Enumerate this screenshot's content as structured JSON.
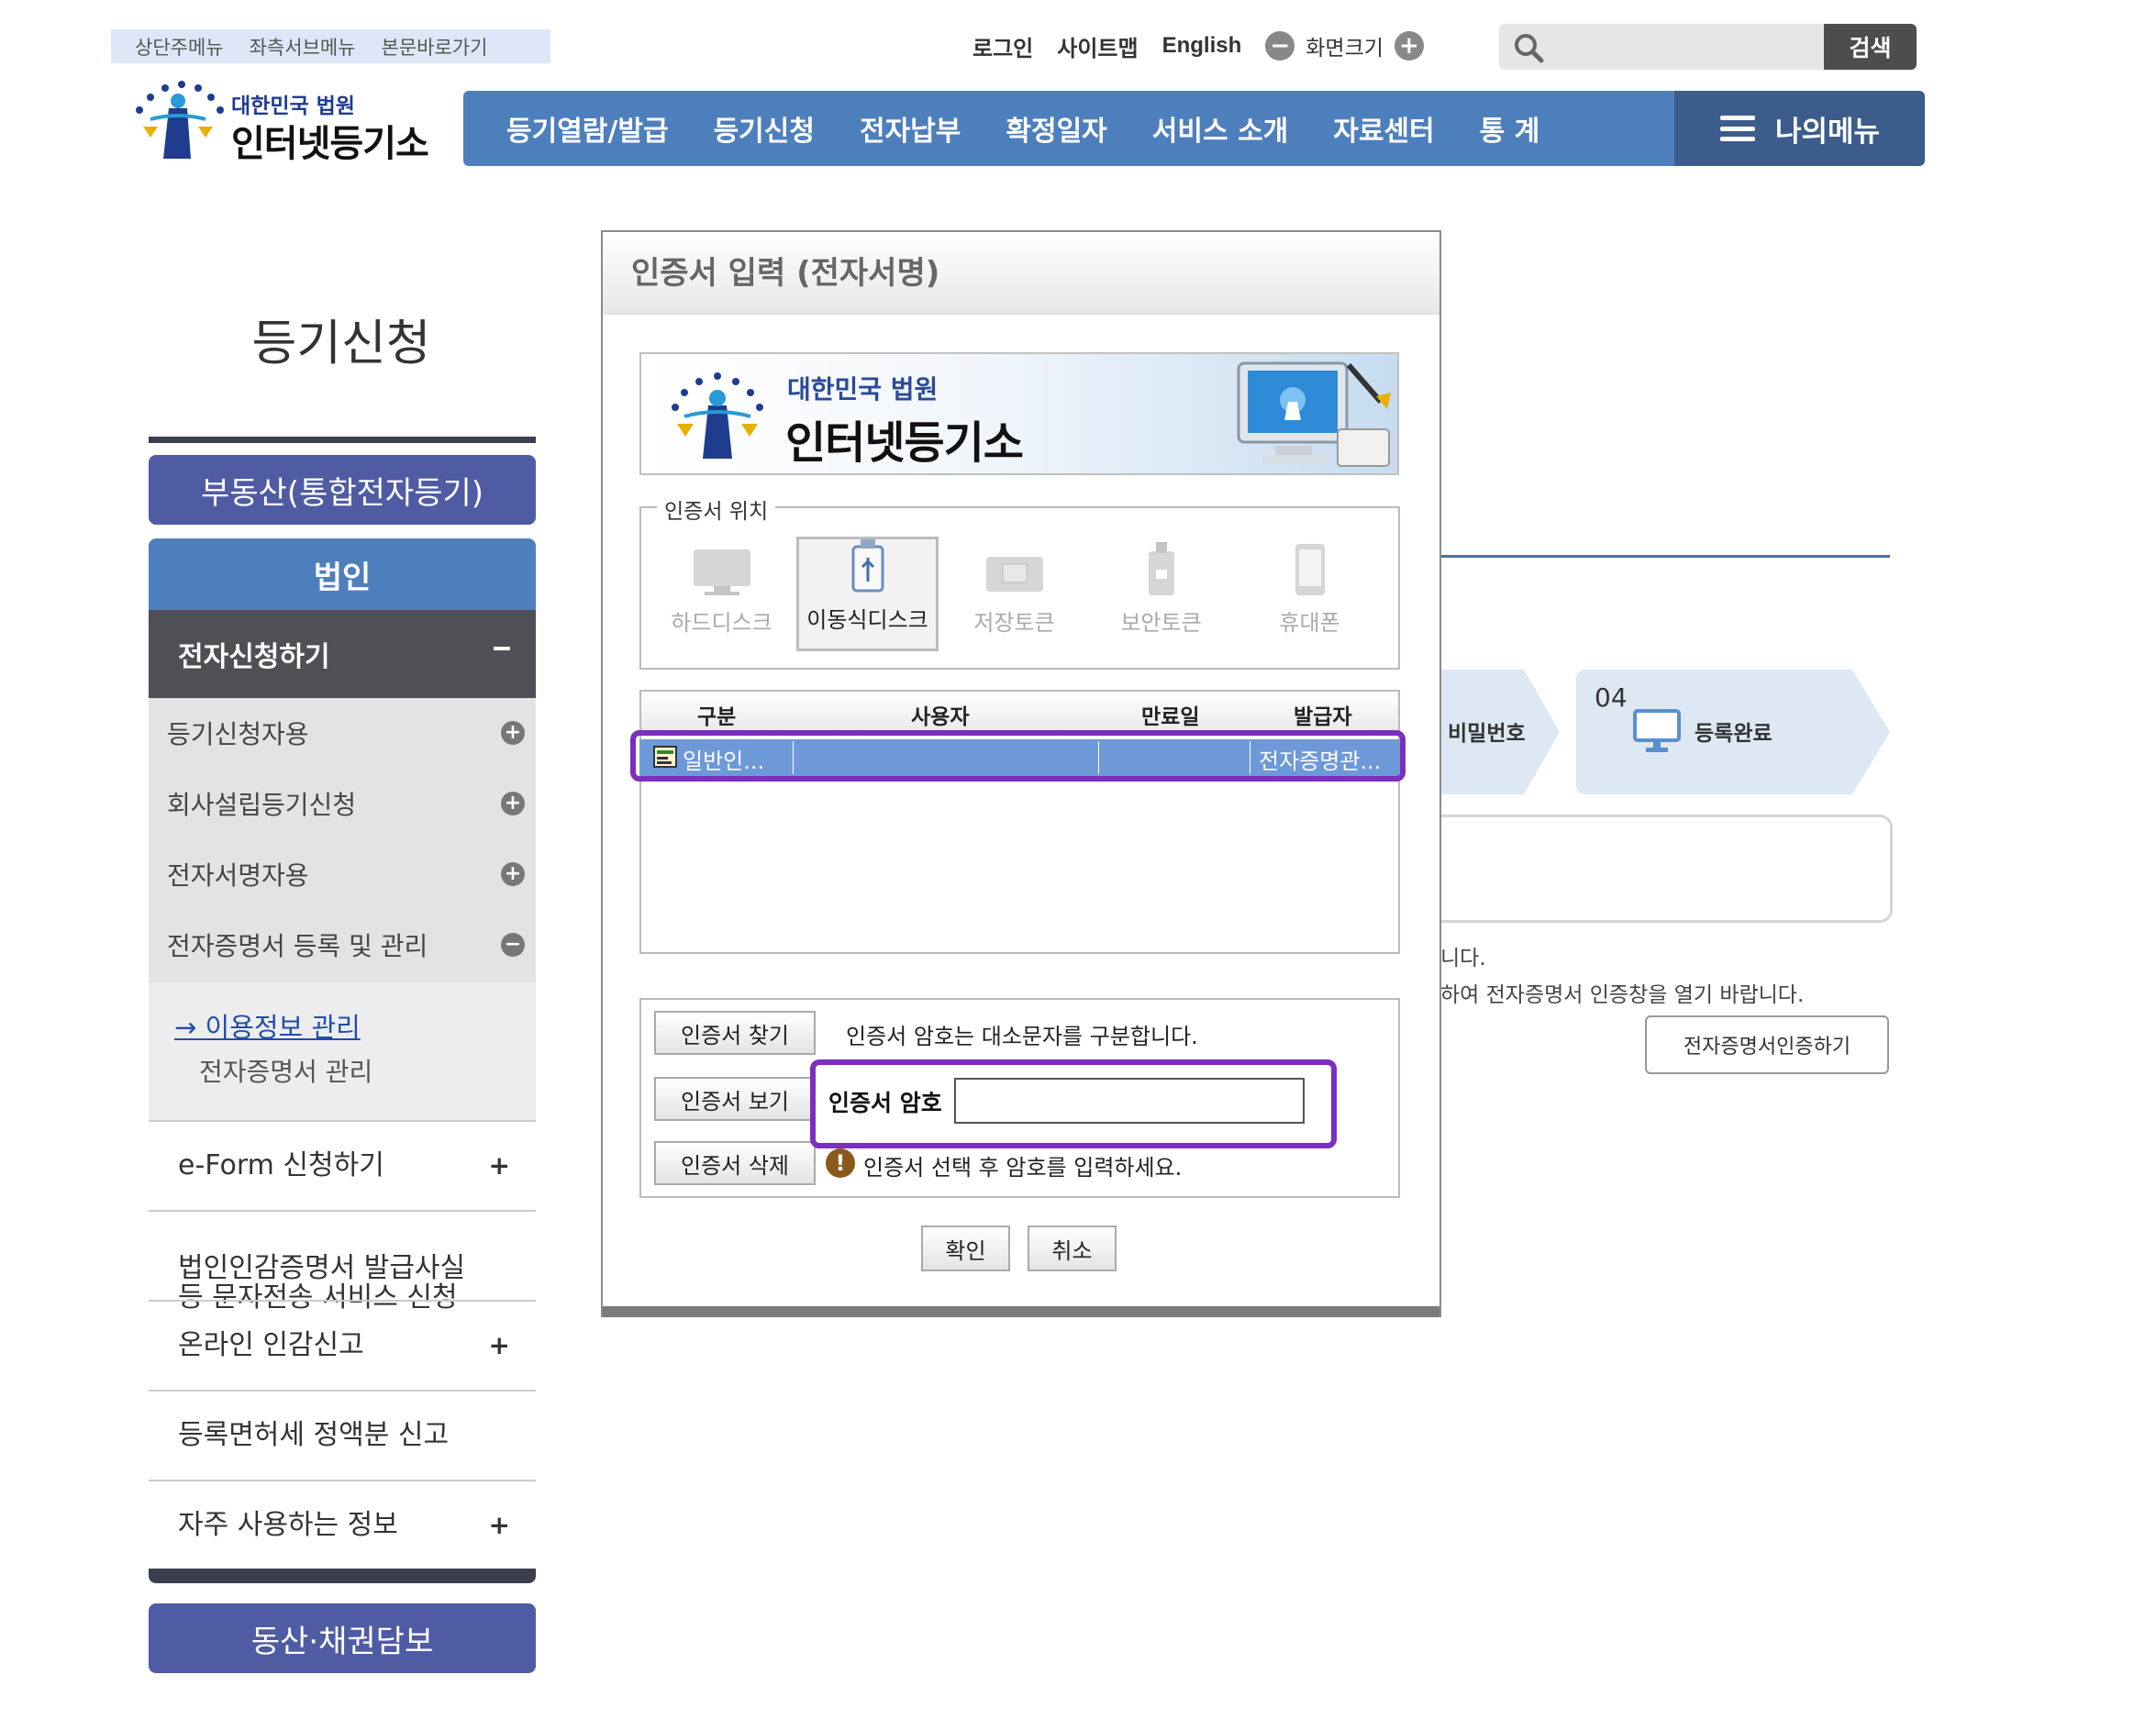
{
  "skipnav": [
    "상단주메뉴",
    "좌측서브메뉴",
    "본문바로가기"
  ],
  "utility": {
    "login": "로그인",
    "sitemap": "사이트맵",
    "english": "English",
    "fontsize": "화면크기",
    "minus": "−",
    "plus": "+"
  },
  "search": {
    "placeholder": "",
    "button": "검색"
  },
  "logo": {
    "small": "대한민국 법원",
    "big": "인터넷등기소"
  },
  "gnb": [
    "등기열람/발급",
    "등기신청",
    "전자납부",
    "확정일자",
    "서비스 소개",
    "자료센터",
    "통 계"
  ],
  "mymenu": "나의메뉴",
  "sidebar": {
    "title": "등기신청",
    "cat_realestate": "부동산(통합전자등기)",
    "cat_corp": "법인",
    "open_item": "전자신청하기",
    "sub_items": [
      "등기신청자용",
      "회사설립등기신청",
      "전자서명자용",
      "전자증명서 등록 및 관리"
    ],
    "sub3_link1": "→ 이용정보 관리",
    "sub3_link2": "전자증명서 관리",
    "rows": [
      "e-Form 신청하기",
      "법인인감증명서 발급사실\n등 문자전송 서비스 신청",
      "온라인 인감신고",
      "등록면허세 정액분 신고",
      "자주 사용하는 정보"
    ],
    "cat_movable": "동산·채권담보"
  },
  "background": {
    "step3_label": "비밀번호",
    "step4_num": "04",
    "step4_label": "등록완료",
    "text1": "니다.",
    "text2": "하여 전자증명서 인증창을 열기 바랍니다.",
    "button": "전자증명서인증하기"
  },
  "dialog": {
    "title": "인증서 입력 (전자서명)",
    "banner_small": "대한민국 법원",
    "banner_big": "인터넷등기소",
    "location_legend": "인증서 위치",
    "locations": [
      "하드디스크",
      "이동식디스크",
      "저장토큰",
      "보안토큰",
      "휴대폰"
    ],
    "table_headers": [
      "구분",
      "사용자",
      "만료일",
      "발급자"
    ],
    "row": {
      "type": "일반인...",
      "user": "",
      "expiry": "",
      "issuer": "전자증명관..."
    },
    "find_btn": "인증서 찾기",
    "view_btn": "인증서 보기",
    "delete_btn": "인증서 삭제",
    "case_note": "인증서 암호는 대소문자를 구분합니다.",
    "pw_label": "인증서 암호",
    "pw_value": "",
    "warn_icon": "!",
    "warn_text": "인증서 선택 후 암호를 입력하세요.",
    "ok": "확인",
    "cancel": "취소"
  },
  "colors": {
    "nav": "#4e7fbd",
    "mymenu": "#3c5d8c",
    "category": "#4f5ca3",
    "highlight": "#7b2fbe",
    "selected_row": "#6e99d8"
  }
}
